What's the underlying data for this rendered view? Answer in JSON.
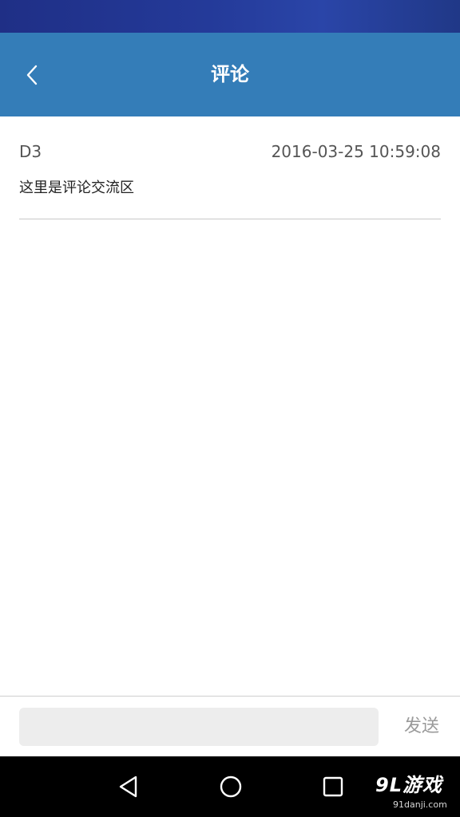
{
  "header": {
    "title": "评论",
    "back_icon": "chevron-left-icon"
  },
  "comments": [
    {
      "author": "D3",
      "time": "2016-03-25 10:59:08",
      "text": "这里是评论交流区"
    }
  ],
  "input_bar": {
    "value": "",
    "placeholder": "",
    "send_label": "发送"
  },
  "nav_bar": {
    "icons": [
      "back-triangle-icon",
      "home-circle-icon",
      "recent-apps-square-icon"
    ]
  },
  "watermark": {
    "logo_text": "9L游戏",
    "url": "91danji.com"
  },
  "colors": {
    "status_bar": "#243a99",
    "app_bar": "#347db8",
    "send_text": "#9a9a9a",
    "input_bg": "#ededed"
  }
}
